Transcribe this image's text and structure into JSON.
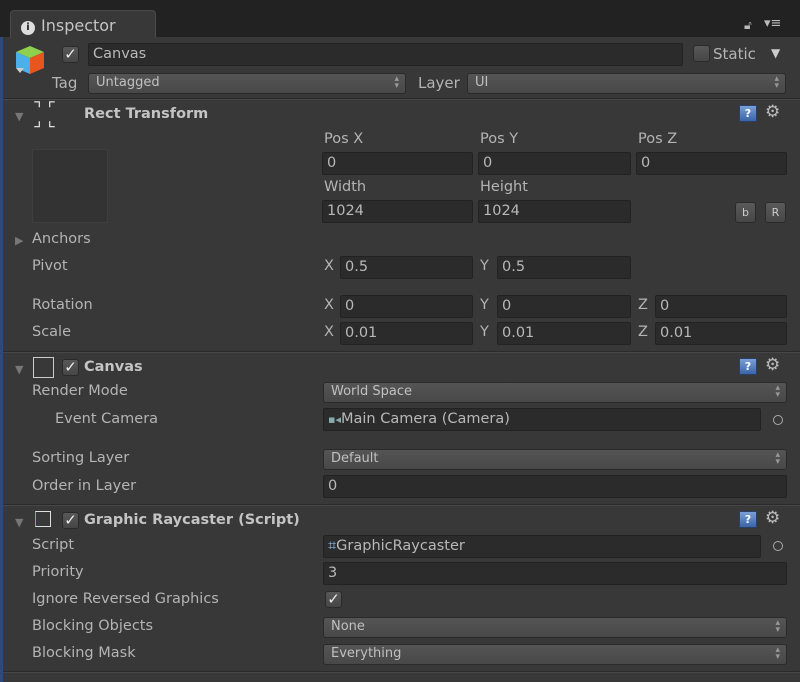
{
  "tab": {
    "title": "Inspector",
    "icon": "info-icon"
  },
  "header": {
    "active": true,
    "name": "Canvas",
    "static_label": "Static",
    "static": false,
    "tag_label": "Tag",
    "tag": "Untagged",
    "layer_label": "Layer",
    "layer": "UI"
  },
  "rect_transform": {
    "title": "Rect Transform",
    "pos_x_label": "Pos X",
    "pos_y_label": "Pos Y",
    "pos_z_label": "Pos Z",
    "pos_x": "0",
    "pos_y": "0",
    "pos_z": "0",
    "width_label": "Width",
    "height_label": "Height",
    "width": "1024",
    "height": "1024",
    "blueprint_btn": "b",
    "raw_btn": "R",
    "anchors_label": "Anchors",
    "pivot_label": "Pivot",
    "pivot_x": "0.5",
    "pivot_y": "0.5",
    "rotation_label": "Rotation",
    "rot_x": "0",
    "rot_y": "0",
    "rot_z": "0",
    "scale_label": "Scale",
    "scale_x": "0.01",
    "scale_y": "0.01",
    "scale_z": "0.01",
    "x": "X",
    "y": "Y",
    "z": "Z"
  },
  "canvas": {
    "title": "Canvas",
    "enabled": true,
    "render_mode_label": "Render Mode",
    "render_mode": "World Space",
    "event_camera_label": "Event Camera",
    "event_camera": "Main Camera (Camera)",
    "sorting_layer_label": "Sorting Layer",
    "sorting_layer": "Default",
    "order_label": "Order in Layer",
    "order": "0"
  },
  "raycaster": {
    "title": "Graphic Raycaster (Script)",
    "enabled": true,
    "script_label": "Script",
    "script": "GraphicRaycaster",
    "priority_label": "Priority",
    "priority": "3",
    "ignore_label": "Ignore Reversed Graphics",
    "ignore_reversed": true,
    "blocking_objects_label": "Blocking Objects",
    "blocking_objects": "None",
    "blocking_mask_label": "Blocking Mask",
    "blocking_mask": "Everything"
  }
}
